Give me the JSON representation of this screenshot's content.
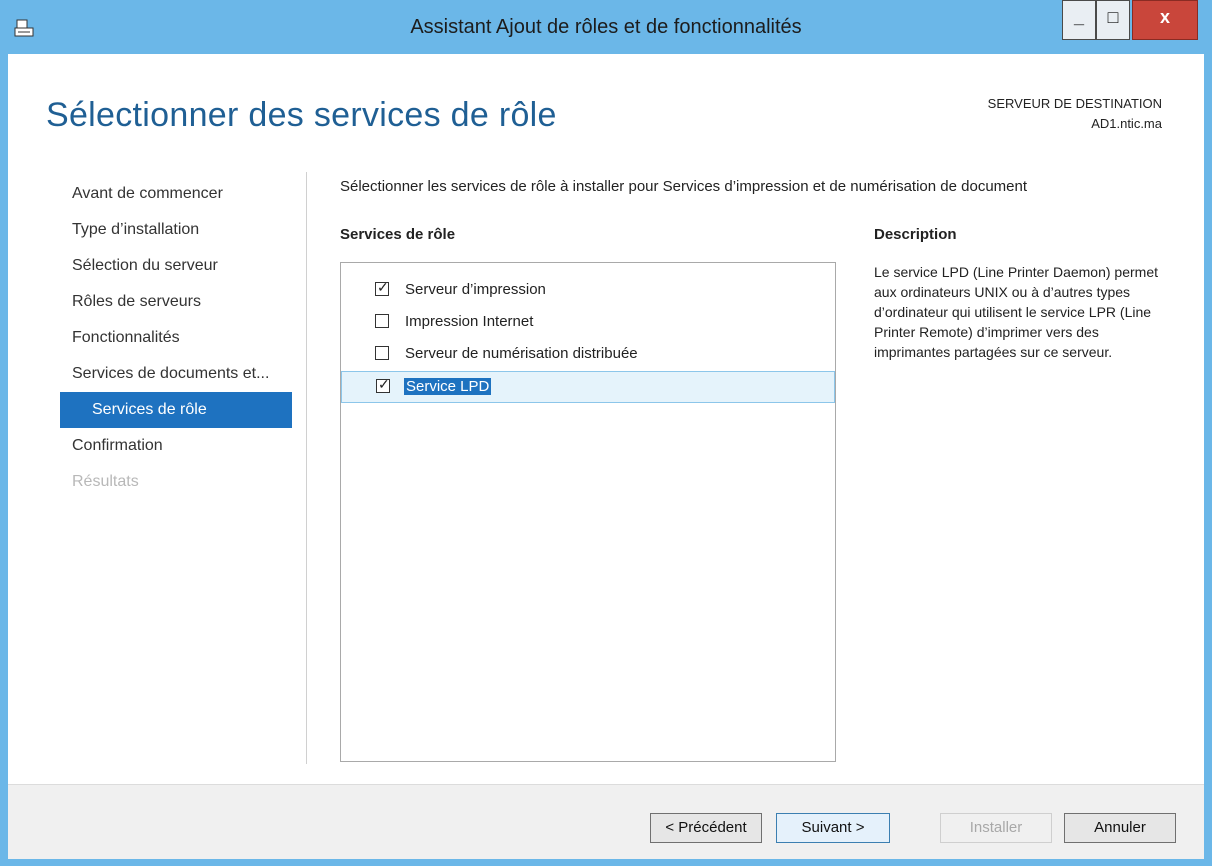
{
  "window": {
    "title": "Assistant Ajout de rôles et de fonctionnalités",
    "minimize_label": "_",
    "maximize_label": "□",
    "close_label": "x",
    "accent": "#6bb7e8"
  },
  "header": {
    "page_title": "Sélectionner des services de rôle",
    "dest_label": "SERVEUR DE DESTINATION",
    "dest_value": "AD1.ntic.ma"
  },
  "nav": {
    "items": [
      {
        "label": "Avant de commencer",
        "state": "normal"
      },
      {
        "label": "Type d’installation",
        "state": "normal"
      },
      {
        "label": "Sélection du serveur",
        "state": "normal"
      },
      {
        "label": "Rôles de serveurs",
        "state": "normal"
      },
      {
        "label": "Fonctionnalités",
        "state": "normal"
      },
      {
        "label": "Services de documents et...",
        "state": "normal"
      },
      {
        "label": "Services de rôle",
        "state": "current"
      },
      {
        "label": "Confirmation",
        "state": "normal"
      },
      {
        "label": "Résultats",
        "state": "disabled"
      }
    ],
    "current_color": "#1e72c0"
  },
  "main": {
    "instruction": "Sélectionner les services de rôle à installer pour Services d’impression et de numérisation de document",
    "roles_header": "Services de rôle",
    "roles": [
      {
        "label": "Serveur d’impression",
        "checked": true,
        "selected": false
      },
      {
        "label": "Impression Internet",
        "checked": false,
        "selected": false
      },
      {
        "label": "Serveur de numérisation distribuée",
        "checked": false,
        "selected": false
      },
      {
        "label": "Service LPD",
        "checked": true,
        "selected": true
      }
    ],
    "check_glyph": "✓",
    "description_header": "Description",
    "description": "Le service LPD (Line Printer Daemon) permet aux ordinateurs UNIX ou à d’autres types d’ordinateur qui utilisent le service LPR (Line Printer Remote) d’imprimer vers des imprimantes partagées sur ce serveur."
  },
  "footer": {
    "prev_label": "< Précédent",
    "next_label": "Suivant >",
    "install_label": "Installer",
    "cancel_label": "Annuler"
  }
}
